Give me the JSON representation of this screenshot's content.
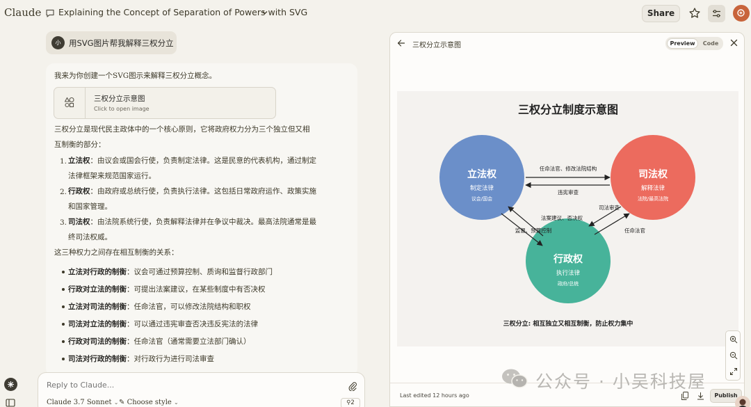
{
  "app": {
    "name": "Claude"
  },
  "header": {
    "chat_title": "Explaining the Concept of Separation of Powers with SVG",
    "share_label": "Share"
  },
  "user_message": {
    "avatar_initial": "小",
    "text": "用SVG图片帮我解释三权分立"
  },
  "assistant": {
    "intro": "我来为你创建一个SVG图示来解释三权分立概念。",
    "artifact_card": {
      "title": "三权分立示意图",
      "subtitle": "Click to open image"
    },
    "explain_line1": "三权分立是现代民主政体中的一个核心原则，它将政府权力分为三个独立但又相",
    "explain_line2": "互制衡的部分：",
    "ordered": [
      {
        "num": "1.",
        "term": "立法权",
        "line1": "：由议会或国会行使，负责制定法律。这是民意的代表机构，通过制定",
        "line2": "法律框架来规范国家运行。"
      },
      {
        "num": "2.",
        "term": "行政权",
        "line1": "：由政府或总统行使，负责执行法律。这包括日常政府运作、政策实施",
        "line2": "和国家管理。"
      },
      {
        "num": "3.",
        "term": "司法权",
        "line1": "：由法院系统行使，负责解释法律并在争议中裁决。最高法院通常是最",
        "line2": "终司法权威。"
      }
    ],
    "relations_intro": "这三种权力之间存在相互制衡的关系：",
    "relations": [
      {
        "term": "立法对行政的制衡",
        "text": "：议会可通过预算控制、质询和监督行政部门"
      },
      {
        "term": "行政对立法的制衡",
        "text": "：可提出法案建议，在某些制度中有否决权"
      },
      {
        "term": "立法对司法的制衡",
        "text": "：任命法官，可以修改法院结构和职权"
      },
      {
        "term": "司法对立法的制衡",
        "text": "：可以通过违宪审查否决违反宪法的法律"
      },
      {
        "term": "行政对司法的制衡",
        "text": "：任命法官（通常需要立法部门确认）"
      },
      {
        "term": "司法对行政的制衡",
        "text": "：对行政行为进行司法审查"
      }
    ]
  },
  "composer": {
    "placeholder": "Reply to Claude...",
    "model": "Claude 3.7 Sonnet",
    "style": "Choose style",
    "collab_count": "2"
  },
  "artifact_panel": {
    "title": "三权分立示意图",
    "tabs": {
      "preview": "Preview",
      "code": "Code"
    },
    "last_edited": "Last edited 12 hours ago",
    "publish_label": "Publish"
  },
  "diagram": {
    "title": "三权分立制度示意图",
    "legislative": {
      "name": "立法权",
      "role": "制定法律",
      "body": "议会/国会",
      "color": "#6b8fc9"
    },
    "judicial": {
      "name": "司法权",
      "role": "解释法律",
      "body": "法院/最高法院",
      "color": "#ec6b5e"
    },
    "executive": {
      "name": "行政权",
      "role": "执行法律",
      "body": "政府/总统",
      "color": "#47b39a"
    },
    "arrow_leg_to_jud": "任命法官、修改法院结构",
    "arrow_jud_to_leg": "违宪审查",
    "arrow_exe_to_leg": "法案建议、否决权",
    "arrow_leg_to_exe": "监督、预算控制",
    "arrow_jud_to_exe": "司法审查",
    "arrow_exe_to_jud": "任命法官",
    "caption": "三权分立: 相互独立又相互制衡，防止权力集中"
  },
  "watermark": {
    "text": "公众号 · 小吴科技屋"
  },
  "colors": {
    "accent": "#c8643b",
    "background": "#f4f2ec"
  }
}
